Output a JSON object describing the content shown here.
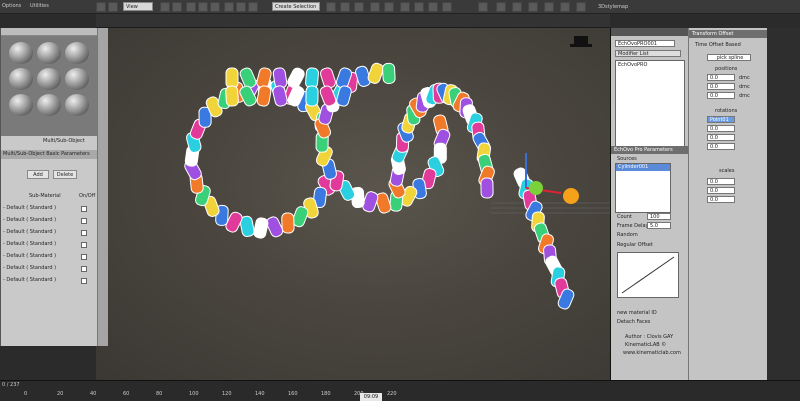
{
  "window": {
    "menu": {
      "options": "Options",
      "utilities": "Utilities"
    },
    "view_dropdown": "View",
    "selection_set": "Create Selection Se",
    "tab_3d_tab": "3Dstylemap"
  },
  "material_editor": {
    "panel_title": "Multi/Sub-Object Basic Parameters",
    "type_label": "Multi/Sub-Object",
    "add_button": "Add",
    "delete_button": "Delete",
    "col_submaterial": "Sub-Material",
    "col_onoff": "On/Off",
    "slots": [
      "- Default ( Standard )",
      "- Default ( Standard )",
      "- Default ( Standard )",
      "- Default ( Standard )",
      "- Default ( Standard )",
      "- Default ( Standard )",
      "- Default ( Standard )"
    ]
  },
  "modifier_panel": {
    "object_name": "EchOvoPRO001",
    "modifier_list": "Modifier List",
    "stack_item": "EchOvoPRO",
    "params_title": "EchOvo Pro Parameters",
    "sources_label": "Sources",
    "source_item": "Cylinder001",
    "count_label": "Count",
    "count_value": "100",
    "frame_delay_label": "Frame Delay",
    "frame_delay_value": "5.0",
    "random_label": "Random",
    "regular_offset_label": "Regular Offset",
    "new_material_label": "new material ID",
    "detach_faces_label": "Detach Faces",
    "author": "Author : Clovis GAY",
    "company": "KinematicLAB ©",
    "website": "www.kinematiclab.com"
  },
  "transform_panel": {
    "title": "Transform Offset",
    "time_offset_based": "Time Offset Based",
    "pick_spline": "pick spline",
    "positions_label": "positions",
    "pos_x": "0.0",
    "pos_y": "0.0",
    "pos_z": "0.0",
    "rotations_label": "rotations",
    "rot_button": "Point01",
    "rot_x": "0.0",
    "rot_y": "0.0",
    "rot_z": "0.0",
    "scales_label": "scales",
    "scale_x": "0.0",
    "scale_y": "0.0",
    "scale_z": "0.0",
    "unit": "dmc"
  },
  "timeline": {
    "range": "0 / 237",
    "current_frame": "09:09",
    "ticks": [
      "0",
      "20",
      "40",
      "60",
      "80",
      "100",
      "120",
      "140",
      "160",
      "180",
      "200",
      "220"
    ]
  },
  "colors": {
    "accent_blue": "#3a6fd8",
    "viewport_bg": "#4a463f"
  }
}
